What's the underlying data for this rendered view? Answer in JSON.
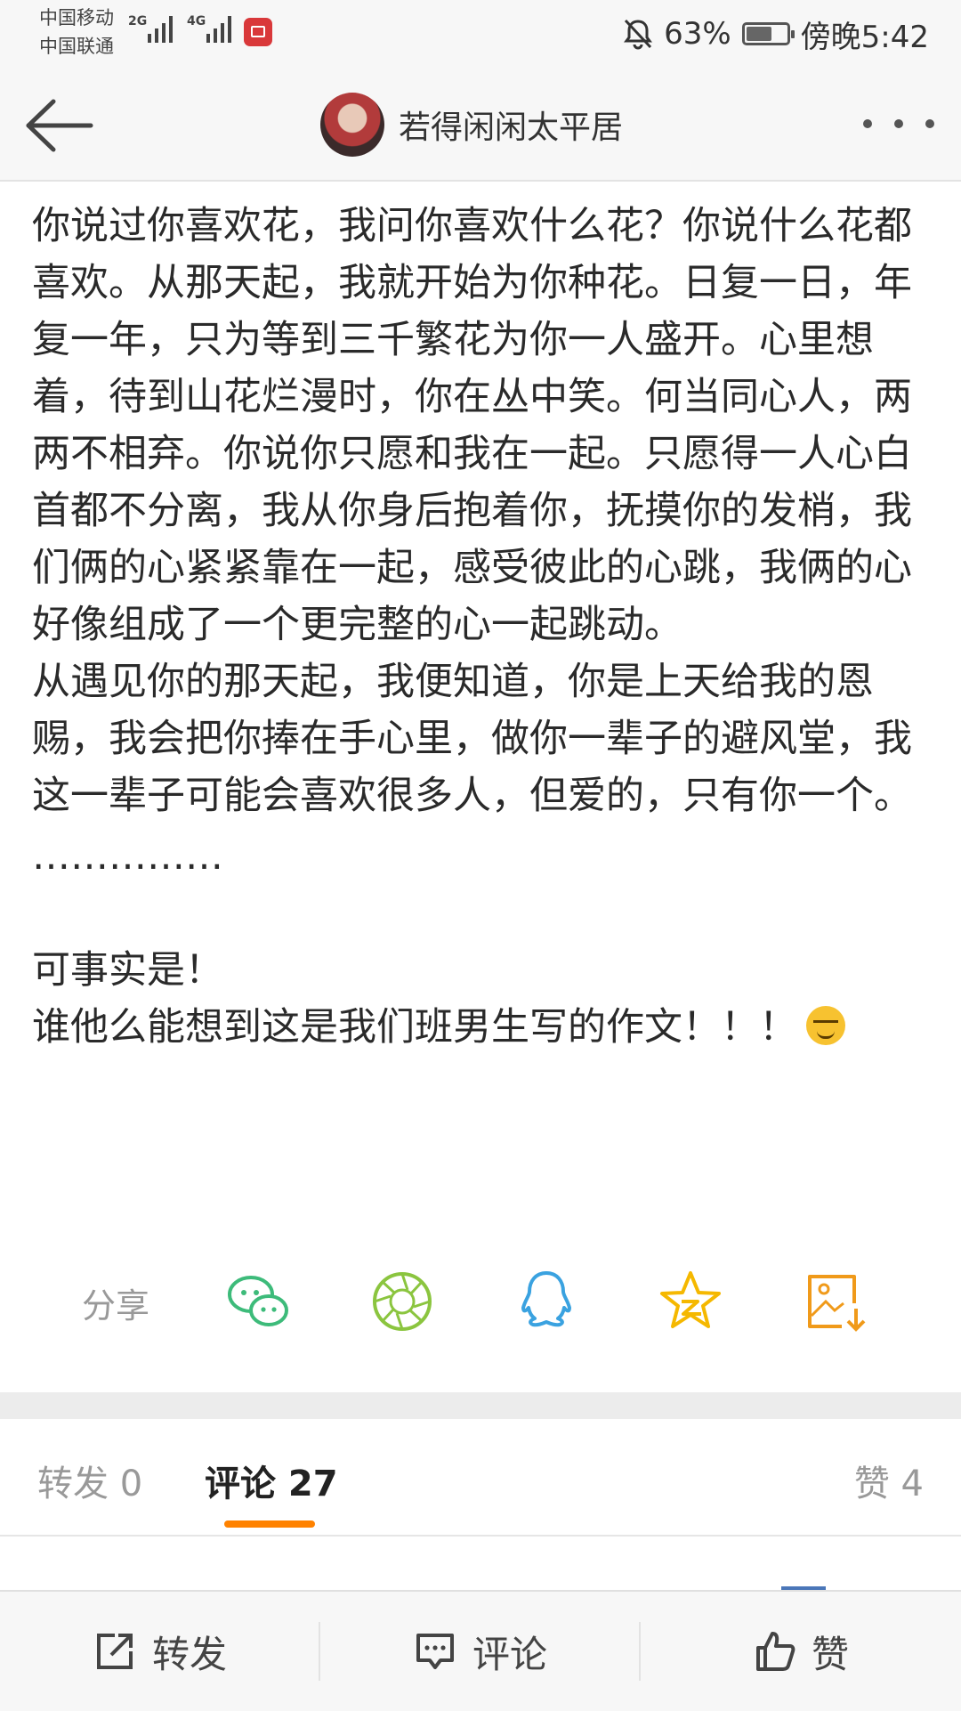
{
  "status_bar": {
    "carrier1": "中国移动",
    "carrier2": "中国联通",
    "net1": "2G",
    "net2": "4G",
    "battery_percent": "63%",
    "battery_level": 0.63,
    "time": "傍晚5:42",
    "icons": [
      "signal-bars-icon",
      "mute-bell-icon",
      "battery-icon",
      "book-app-icon"
    ]
  },
  "nav": {
    "title": "若得闲闲太平居"
  },
  "article": {
    "paragraphs": [
      "你说过你喜欢花，我问你喜欢什么花？你说什么花都喜欢。从那天起，我就开始为你种花。日复一日，年复一年，只为等到三千繁花为你一人盛开。心里想着，待到山花烂漫时，你在丛中笑。何当同心人，两两不相弃。你说你只愿和我在一起。只愿得一人心白首都不分离，我从你身后抱着你，抚摸你的发梢，我们俩的心紧紧靠在一起，感受彼此的心跳，我俩的心好像组成了一个更完整的心一起跳动。",
      "从遇见你的那天起，我便知道，你是上天给我的恩赐，我会把你捧在手心里，做你一辈子的避风堂，我这一辈子可能会喜欢很多人，但爱的，只有你一个。",
      "……………",
      "可事实是！",
      "谁他么能想到这是我们班男生写的作文！！！"
    ]
  },
  "share": {
    "label": "分享",
    "icons": [
      "wechat-icon",
      "moments-icon",
      "qq-icon",
      "qzone-icon",
      "save-image-icon"
    ],
    "colors": {
      "wechat": "#3dbb7a",
      "moments": "#8bc53f",
      "qq": "#3aa2e0",
      "qzone": "#f5b800",
      "save": "#f09a1a"
    }
  },
  "tabs": {
    "repost": "转发 0",
    "comments": "评论 27",
    "likes": "赞 4",
    "accent": "#ff8200"
  },
  "bottom_bar": {
    "repost": "转发",
    "comment": "评论",
    "like": "赞"
  }
}
